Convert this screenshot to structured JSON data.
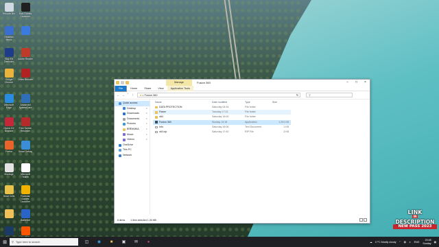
{
  "desktop": {
    "icons": [
      {
        "label": "Recycle Bin",
        "color": "#cfd8e3"
      },
      {
        "label": "Epic Games Launcher",
        "color": "#202020"
      },
      {
        "label": "Obsidian Music",
        "color": "#3a6fd0"
      },
      {
        "label": "",
        "color": "#3b7be0"
      },
      {
        "label": "Slay Ed Defender",
        "color": "#1e3c8a"
      },
      {
        "label": "Adobe Reader",
        "color": "#c03a2b"
      },
      {
        "label": "Google Chrome",
        "color": "#e9b33c"
      },
      {
        "label": "Driver Booster",
        "color": "#b32222"
      },
      {
        "label": "Microsoft Edge",
        "color": "#2a8ce0"
      },
      {
        "label": "Advanced SystemCare",
        "color": "#2f6fb8"
      },
      {
        "label": "Opera GX Browser",
        "color": "#c3273a"
      },
      {
        "label": "Free Screen Recorder",
        "color": "#b52a2a"
      },
      {
        "label": "Firefox",
        "color": "#e8642b"
      },
      {
        "label": "Smart Defrag",
        "color": "#3a8ed8"
      },
      {
        "label": "Montage",
        "color": "#e3e3e3"
      },
      {
        "label": "Microsoft Teams",
        "color": "#ffffff"
      },
      {
        "label": "Dead Cells",
        "color": "#e8c24a"
      },
      {
        "label": "Rockstar Games Launcher",
        "color": "#f2b300"
      },
      {
        "label": "",
        "color": "#efc05a"
      },
      {
        "label": "BattleNet",
        "color": "#2a64c8"
      },
      {
        "label": "Steam",
        "color": "#1b3a66"
      },
      {
        "label": "FACEIT",
        "color": "#ff5500"
      }
    ]
  },
  "window": {
    "title": "Fusion 360",
    "manage_tab": "Manage",
    "ribbon_tabs": [
      "File",
      "Home",
      "Share",
      "View",
      "Application Tools"
    ],
    "address_path": "Fusion 360",
    "search_placeholder": "",
    "nav_pane": [
      {
        "label": "Quick access",
        "sub": false,
        "selected": true,
        "color": "#4a90e2"
      },
      {
        "label": "Desktop",
        "sub": true,
        "selected": false,
        "color": "#3b82d6"
      },
      {
        "label": "Downloads",
        "sub": true,
        "selected": false,
        "color": "#2b6fd0"
      },
      {
        "label": "Documents",
        "sub": true,
        "selected": false,
        "color": "#a0a0a0"
      },
      {
        "label": "Pictures",
        "sub": true,
        "selected": false,
        "color": "#3a9ad9"
      },
      {
        "label": "ВЯЁЖИКА",
        "sub": true,
        "selected": false,
        "color": "#e9c25b"
      },
      {
        "label": "Music",
        "sub": true,
        "selected": false,
        "color": "#7a6ad1"
      },
      {
        "label": "Videos",
        "sub": true,
        "selected": false,
        "color": "#7a6ad1"
      },
      {
        "label": "OneDrive",
        "sub": false,
        "selected": false,
        "color": "#2a7ad8"
      },
      {
        "label": "This PC",
        "sub": false,
        "selected": false,
        "color": "#5aa0e0"
      },
      {
        "label": "Network",
        "sub": false,
        "selected": false,
        "color": "#3a7dd0"
      }
    ],
    "columns": {
      "name": "Name",
      "date": "Date modified",
      "type": "Type",
      "size": "Size"
    },
    "files": [
      {
        "name": "DATA PROTECTION",
        "date": "Saturday 04:34",
        "type": "File folder",
        "size": "",
        "kind": "folder",
        "state": ""
      },
      {
        "name": "Flame",
        "date": "Tuesday 17:21",
        "type": "File folder",
        "size": "",
        "kind": "folder",
        "state": "hover"
      },
      {
        "name": "x64",
        "date": "Saturday 16:00",
        "type": "File folder",
        "size": "",
        "kind": "folder",
        "state": ""
      },
      {
        "name": "Fusion 360",
        "date": "Sunday 13:18",
        "type": "Application",
        "size": "1,291 KB",
        "kind": "app",
        "state": "sel"
      },
      {
        "name": "Info",
        "date": "Saturday 16:06",
        "type": "Text Document",
        "size": "1 KB",
        "kind": "file",
        "state": ""
      },
      {
        "name": "x64.zip",
        "date": "Saturday 17:40",
        "type": "RIP File",
        "size": "3 KB",
        "kind": "file",
        "state": ""
      }
    ],
    "status": {
      "items": "6 items",
      "selected": "1 item selected  1.26 MB"
    }
  },
  "taskbar": {
    "search_placeholder": "Type here to search",
    "weather": "17°C  Mostly cloudy",
    "lang": "ENG",
    "time": "20:48",
    "day": "Sunday"
  },
  "watermark": {
    "line1": "LINK",
    "line2": "IN",
    "line3": "DESCRIPTION",
    "line4": "NEW PASS 2023"
  }
}
